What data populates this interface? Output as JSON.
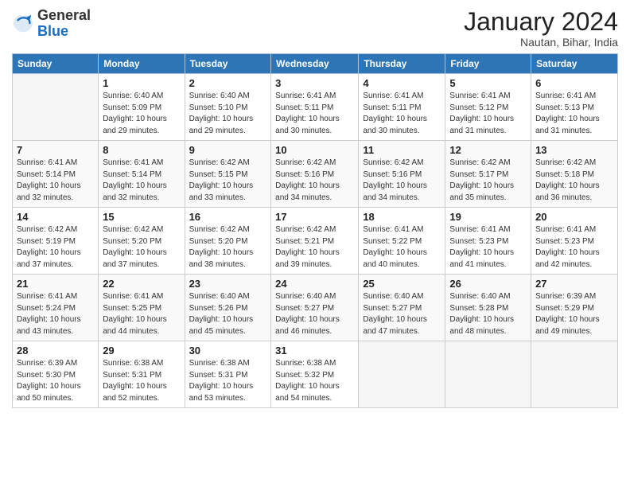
{
  "header": {
    "logo_general": "General",
    "logo_blue": "Blue",
    "month": "January 2024",
    "location": "Nautan, Bihar, India"
  },
  "weekdays": [
    "Sunday",
    "Monday",
    "Tuesday",
    "Wednesday",
    "Thursday",
    "Friday",
    "Saturday"
  ],
  "weeks": [
    [
      {
        "day": "",
        "info": ""
      },
      {
        "day": "1",
        "info": "Sunrise: 6:40 AM\nSunset: 5:09 PM\nDaylight: 10 hours\nand 29 minutes."
      },
      {
        "day": "2",
        "info": "Sunrise: 6:40 AM\nSunset: 5:10 PM\nDaylight: 10 hours\nand 29 minutes."
      },
      {
        "day": "3",
        "info": "Sunrise: 6:41 AM\nSunset: 5:11 PM\nDaylight: 10 hours\nand 30 minutes."
      },
      {
        "day": "4",
        "info": "Sunrise: 6:41 AM\nSunset: 5:11 PM\nDaylight: 10 hours\nand 30 minutes."
      },
      {
        "day": "5",
        "info": "Sunrise: 6:41 AM\nSunset: 5:12 PM\nDaylight: 10 hours\nand 31 minutes."
      },
      {
        "day": "6",
        "info": "Sunrise: 6:41 AM\nSunset: 5:13 PM\nDaylight: 10 hours\nand 31 minutes."
      }
    ],
    [
      {
        "day": "7",
        "info": "Sunrise: 6:41 AM\nSunset: 5:14 PM\nDaylight: 10 hours\nand 32 minutes."
      },
      {
        "day": "8",
        "info": "Sunrise: 6:41 AM\nSunset: 5:14 PM\nDaylight: 10 hours\nand 32 minutes."
      },
      {
        "day": "9",
        "info": "Sunrise: 6:42 AM\nSunset: 5:15 PM\nDaylight: 10 hours\nand 33 minutes."
      },
      {
        "day": "10",
        "info": "Sunrise: 6:42 AM\nSunset: 5:16 PM\nDaylight: 10 hours\nand 34 minutes."
      },
      {
        "day": "11",
        "info": "Sunrise: 6:42 AM\nSunset: 5:16 PM\nDaylight: 10 hours\nand 34 minutes."
      },
      {
        "day": "12",
        "info": "Sunrise: 6:42 AM\nSunset: 5:17 PM\nDaylight: 10 hours\nand 35 minutes."
      },
      {
        "day": "13",
        "info": "Sunrise: 6:42 AM\nSunset: 5:18 PM\nDaylight: 10 hours\nand 36 minutes."
      }
    ],
    [
      {
        "day": "14",
        "info": "Sunrise: 6:42 AM\nSunset: 5:19 PM\nDaylight: 10 hours\nand 37 minutes."
      },
      {
        "day": "15",
        "info": "Sunrise: 6:42 AM\nSunset: 5:20 PM\nDaylight: 10 hours\nand 37 minutes."
      },
      {
        "day": "16",
        "info": "Sunrise: 6:42 AM\nSunset: 5:20 PM\nDaylight: 10 hours\nand 38 minutes."
      },
      {
        "day": "17",
        "info": "Sunrise: 6:42 AM\nSunset: 5:21 PM\nDaylight: 10 hours\nand 39 minutes."
      },
      {
        "day": "18",
        "info": "Sunrise: 6:41 AM\nSunset: 5:22 PM\nDaylight: 10 hours\nand 40 minutes."
      },
      {
        "day": "19",
        "info": "Sunrise: 6:41 AM\nSunset: 5:23 PM\nDaylight: 10 hours\nand 41 minutes."
      },
      {
        "day": "20",
        "info": "Sunrise: 6:41 AM\nSunset: 5:23 PM\nDaylight: 10 hours\nand 42 minutes."
      }
    ],
    [
      {
        "day": "21",
        "info": "Sunrise: 6:41 AM\nSunset: 5:24 PM\nDaylight: 10 hours\nand 43 minutes."
      },
      {
        "day": "22",
        "info": "Sunrise: 6:41 AM\nSunset: 5:25 PM\nDaylight: 10 hours\nand 44 minutes."
      },
      {
        "day": "23",
        "info": "Sunrise: 6:40 AM\nSunset: 5:26 PM\nDaylight: 10 hours\nand 45 minutes."
      },
      {
        "day": "24",
        "info": "Sunrise: 6:40 AM\nSunset: 5:27 PM\nDaylight: 10 hours\nand 46 minutes."
      },
      {
        "day": "25",
        "info": "Sunrise: 6:40 AM\nSunset: 5:27 PM\nDaylight: 10 hours\nand 47 minutes."
      },
      {
        "day": "26",
        "info": "Sunrise: 6:40 AM\nSunset: 5:28 PM\nDaylight: 10 hours\nand 48 minutes."
      },
      {
        "day": "27",
        "info": "Sunrise: 6:39 AM\nSunset: 5:29 PM\nDaylight: 10 hours\nand 49 minutes."
      }
    ],
    [
      {
        "day": "28",
        "info": "Sunrise: 6:39 AM\nSunset: 5:30 PM\nDaylight: 10 hours\nand 50 minutes."
      },
      {
        "day": "29",
        "info": "Sunrise: 6:38 AM\nSunset: 5:31 PM\nDaylight: 10 hours\nand 52 minutes."
      },
      {
        "day": "30",
        "info": "Sunrise: 6:38 AM\nSunset: 5:31 PM\nDaylight: 10 hours\nand 53 minutes."
      },
      {
        "day": "31",
        "info": "Sunrise: 6:38 AM\nSunset: 5:32 PM\nDaylight: 10 hours\nand 54 minutes."
      },
      {
        "day": "",
        "info": ""
      },
      {
        "day": "",
        "info": ""
      },
      {
        "day": "",
        "info": ""
      }
    ]
  ]
}
